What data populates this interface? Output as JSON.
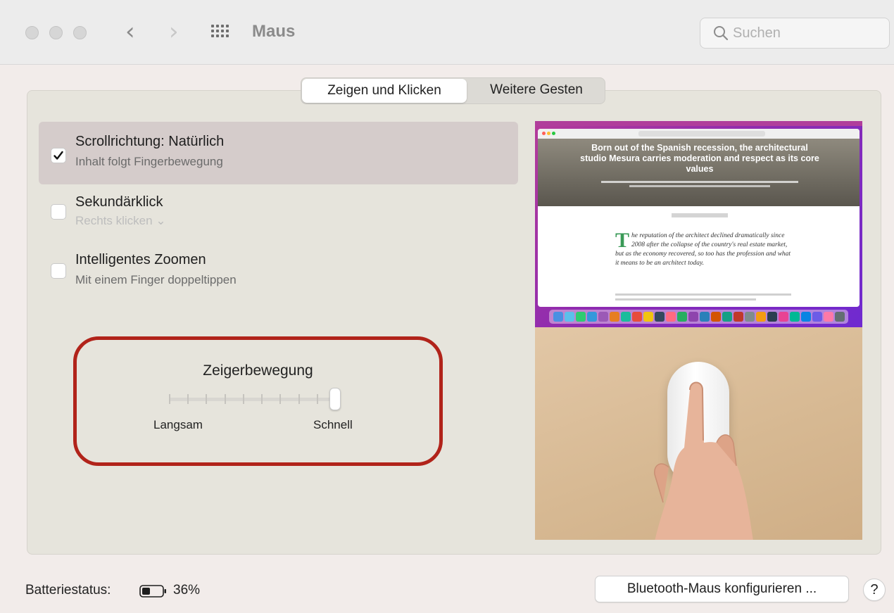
{
  "window": {
    "title": "Maus",
    "search_placeholder": "Suchen"
  },
  "tabs": [
    {
      "label": "Zeigen und Klicken",
      "active": true
    },
    {
      "label": "Weitere Gesten",
      "active": false
    }
  ],
  "options": [
    {
      "title": "Scrollrichtung: Natürlich",
      "subtitle": "Inhalt folgt Fingerbewegung",
      "checked": true
    },
    {
      "title": "Sekundärklick",
      "subtitle": "Rechts klicken ⌄",
      "checked": false
    },
    {
      "title": "Intelligentes Zoomen",
      "subtitle": "Mit einem Finger doppeltippen",
      "checked": false
    }
  ],
  "pointer_speed": {
    "title": "Zeigerbewegung",
    "min_label": "Langsam",
    "max_label": "Schnell",
    "value_fraction": 1.0,
    "tick_count": 10
  },
  "preview": {
    "headline": "Born out of the Spanish recession, the architectural studio Mesura carries moderation and respect as its core values",
    "drop_cap": "T",
    "article_text": "he reputation of the architect declined dramatically since 2008 after the collapse of the country's real estate market, but as the economy recovered, so too has the profession and what it means to be an architect today."
  },
  "footer": {
    "battery_label": "Batteriestatus:",
    "battery_percent": "36%",
    "configure_button": "Bluetooth-Maus konfigurieren ...",
    "help_button": "?"
  },
  "colors": {
    "highlight": "#b1231a",
    "selected_row": "#d5cccb",
    "panel": "#e6e4dc"
  }
}
